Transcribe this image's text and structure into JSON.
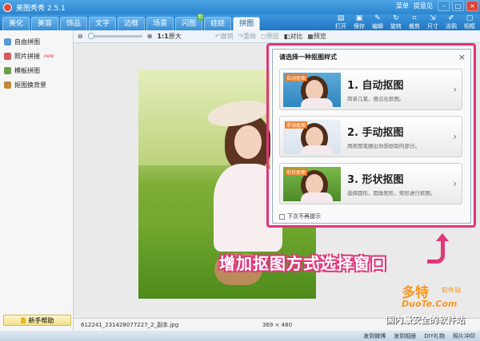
{
  "window": {
    "title": "美图秀秀 2.5.1",
    "menu_link": "菜单",
    "feedback_link": "提意见"
  },
  "tabs": [
    {
      "label": "美化"
    },
    {
      "label": "美容"
    },
    {
      "label": "饰品"
    },
    {
      "label": "文字"
    },
    {
      "label": "边框"
    },
    {
      "label": "场景"
    },
    {
      "label": "闪图",
      "badge": "新"
    },
    {
      "label": "娃娃"
    },
    {
      "label": "拼图"
    }
  ],
  "tools": [
    {
      "label": "打开",
      "icon": "folder-icon"
    },
    {
      "label": "保存",
      "icon": "save-icon"
    },
    {
      "label": "编辑",
      "icon": "pencil-icon"
    },
    {
      "label": "旋转",
      "icon": "rotate-icon"
    },
    {
      "label": "裁剪",
      "icon": "crop-icon"
    },
    {
      "label": "尺寸",
      "icon": "resize-icon"
    },
    {
      "label": "涂鸦",
      "icon": "brush-icon"
    },
    {
      "label": "相框",
      "icon": "frame-icon"
    }
  ],
  "sidebar": {
    "items": [
      {
        "label": "自由拼图",
        "icon": "freeform-icon",
        "color": "#5a9ad6"
      },
      {
        "label": "照片拼接",
        "icon": "photo-join-icon",
        "color": "#d65a5a",
        "new": "new"
      },
      {
        "label": "模板拼图",
        "icon": "template-icon",
        "color": "#6aa04a"
      },
      {
        "label": "抠图换背景",
        "icon": "cutout-icon",
        "color": "#c08a3a"
      }
    ],
    "help_label": "新手帮助"
  },
  "canvas_toolbar": {
    "zoom": "1:1",
    "zoom_original": "原大",
    "undo": "撤销",
    "redo": "重做",
    "reset": "原图",
    "compare": "对比",
    "preview": "预览"
  },
  "status": {
    "filename": "612241_231428077227_2_副本.jpg",
    "dims": "369 × 480"
  },
  "bottom_links": [
    "发到微博",
    "发到相册",
    "DIY礼物",
    "照片冲印"
  ],
  "dialog": {
    "title": "请选择一种抠图样式",
    "options": [
      {
        "tag": "自动抠图",
        "title": "1. 自动抠图",
        "desc": "简单几笔，傻瓜化抠图。"
      },
      {
        "tag": "手动抠图",
        "title": "2. 手动抠图",
        "desc": "用抠图笔圈出你想抠取的部分。"
      },
      {
        "tag": "形状抠图",
        "title": "3. 形状抠图",
        "desc": "选择圆形、圆角矩形，矩形进行抠图。"
      }
    ],
    "checkbox_label": "下次不再提示"
  },
  "annotation": "增加抠图方式选择窗口",
  "watermark": {
    "cn": "多特",
    "small": "软件站",
    "en": "DuoTe.Com",
    "slogan": "国内最安全的软件站"
  },
  "colors": {
    "accent": "#e0367a",
    "titlebar": "#2a84cf",
    "watermark": "#f7961e"
  }
}
